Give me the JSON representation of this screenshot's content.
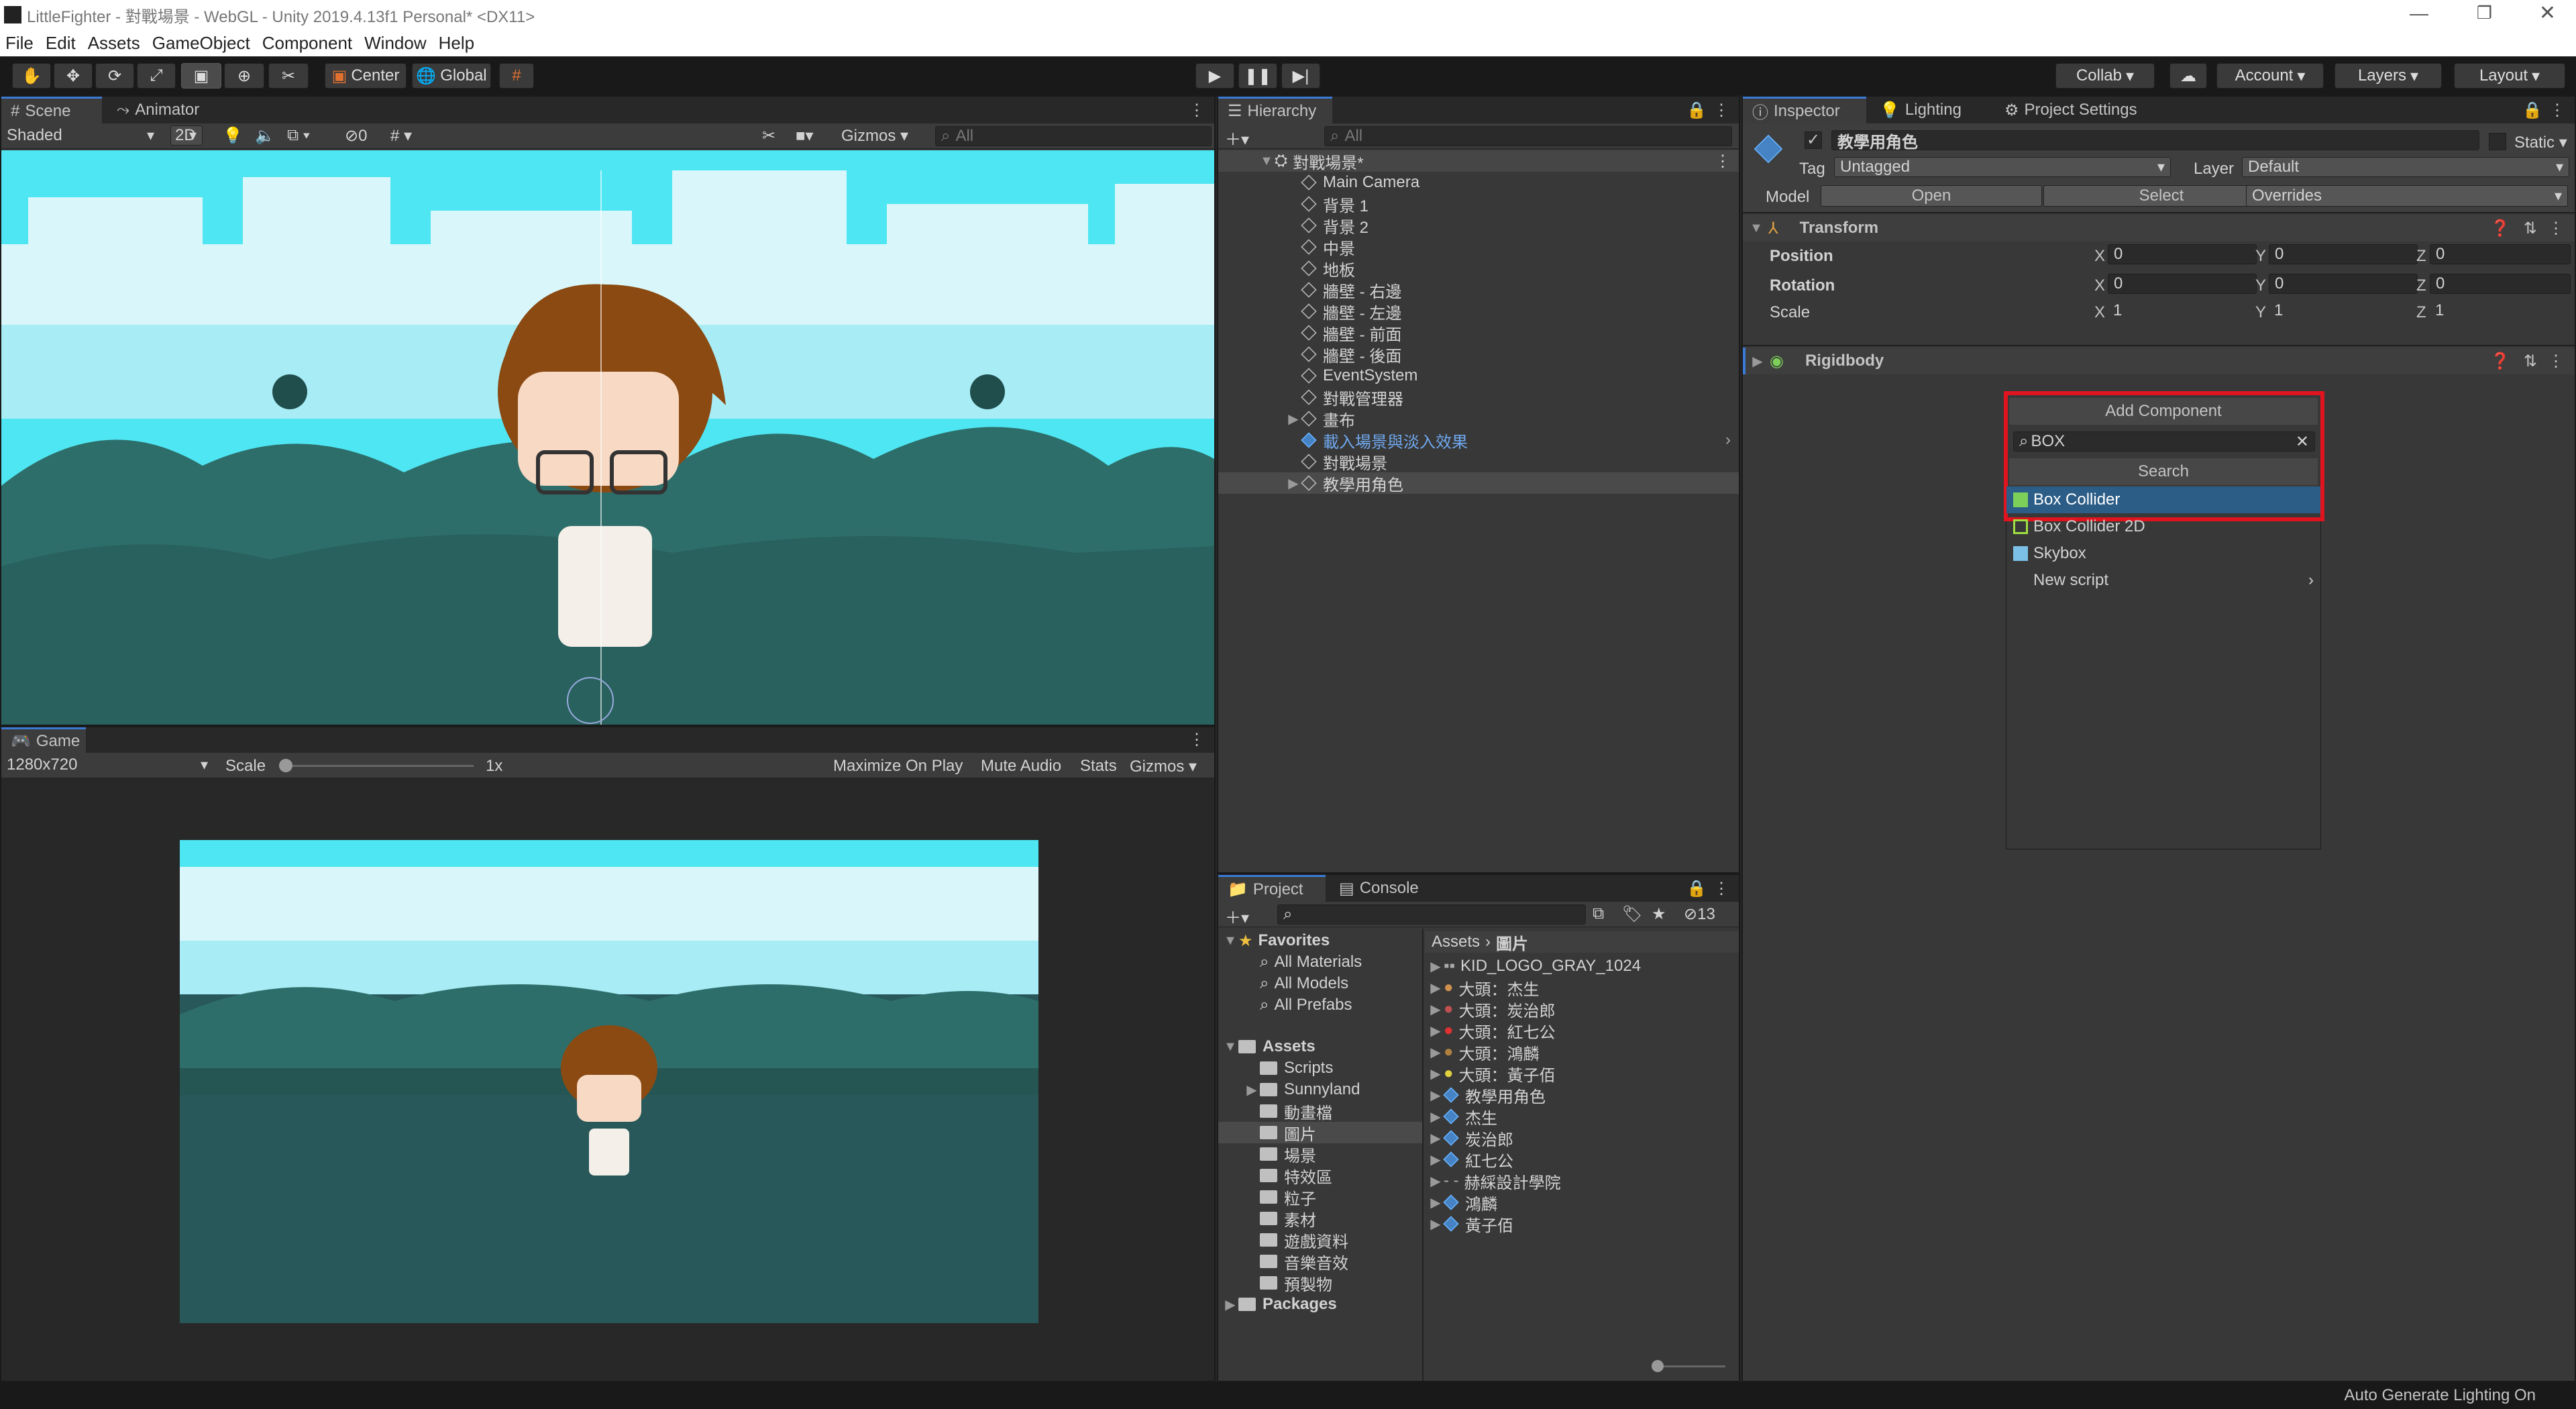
{
  "window": {
    "title": "LittleFighter - 對戰場景 - WebGL - Unity 2019.4.13f1 Personal* <DX11>"
  },
  "menu": [
    "File",
    "Edit",
    "Assets",
    "GameObject",
    "Component",
    "Window",
    "Help"
  ],
  "toolbar": {
    "pivot_label": "Center",
    "space_label": "Global",
    "collab_label": "Collab",
    "account_label": "Account",
    "layers_label": "Layers",
    "layout_label": "Layout"
  },
  "scene": {
    "tab_scene": "Scene",
    "tab_animator": "Animator",
    "shading": "Shaded",
    "mode_2d": "2D",
    "hidden_count": "0",
    "gizmos": "Gizmos",
    "search_placeholder": "All"
  },
  "game": {
    "tab": "Game",
    "resolution": "1280x720",
    "scale_label": "Scale",
    "scale_value": "1x",
    "maximize": "Maximize On Play",
    "mute": "Mute Audio",
    "stats": "Stats",
    "gizmos": "Gizmos"
  },
  "hierarchy": {
    "tab": "Hierarchy",
    "search_placeholder": "All",
    "root": "對戰場景*",
    "items": [
      "Main Camera",
      "背景 1",
      "背景 2",
      "中景",
      "地板",
      "牆壁 - 右邊",
      "牆壁 - 左邊",
      "牆壁 - 前面",
      "牆壁 - 後面",
      "EventSystem",
      "對戰管理器",
      "畫布",
      "載入場景與淡入效果",
      "對戰場景",
      "教學用角色"
    ]
  },
  "project": {
    "tab_project": "Project",
    "tab_console": "Console",
    "hidden_count": "13",
    "favorites_label": "Favorites",
    "favorites": [
      "All Materials",
      "All Models",
      "All Prefabs"
    ],
    "assets_label": "Assets",
    "asset_folders": [
      "Scripts",
      "Sunnyland",
      "動畫檔",
      "圖片",
      "場景",
      "特效區",
      "粒子",
      "素材",
      "遊戲資料",
      "音樂音效",
      "預製物"
    ],
    "packages_label": "Packages",
    "breadcrumb_root": "Assets",
    "breadcrumb_current": "圖片",
    "files": [
      "KID_LOGO_GRAY_1024",
      "大頭：杰生",
      "大頭：炭治郎",
      "大頭：紅七公",
      "大頭：鴻麟",
      "大頭：黃子佰",
      "教學用角色",
      "杰生",
      "炭治郎",
      "紅七公",
      "赫綵設計學院",
      "鴻麟",
      "黃子佰"
    ]
  },
  "inspector": {
    "tab_inspector": "Inspector",
    "tab_lighting": "Lighting",
    "tab_project_settings": "Project Settings",
    "object_name": "教學用角色",
    "static_label": "Static",
    "tag_label": "Tag",
    "tag_value": "Untagged",
    "layer_label": "Layer",
    "layer_value": "Default",
    "model_label": "Model",
    "open_label": "Open",
    "select_label": "Select",
    "overrides_label": "Overrides",
    "transform": {
      "title": "Transform",
      "position_label": "Position",
      "rotation_label": "Rotation",
      "scale_label": "Scale",
      "position": [
        "0",
        "0",
        "0"
      ],
      "rotation": [
        "0",
        "0",
        "0"
      ],
      "scale": [
        "1",
        "1",
        "1"
      ],
      "axis": [
        "X",
        "Y",
        "Z"
      ]
    },
    "rigidbody_title": "Rigidbody"
  },
  "add_component": {
    "title": "Add Component",
    "search_value": "BOX",
    "search_header": "Search",
    "results": [
      "Box Collider",
      "Box Collider 2D",
      "Skybox",
      "New script"
    ]
  },
  "status": {
    "text": "Auto Generate Lighting On"
  },
  "colors": {
    "accent": "#3a7bd5",
    "highlight_border": "#e0141e",
    "selected_row": "#2c5d87",
    "sky": "#4ee6f2"
  }
}
